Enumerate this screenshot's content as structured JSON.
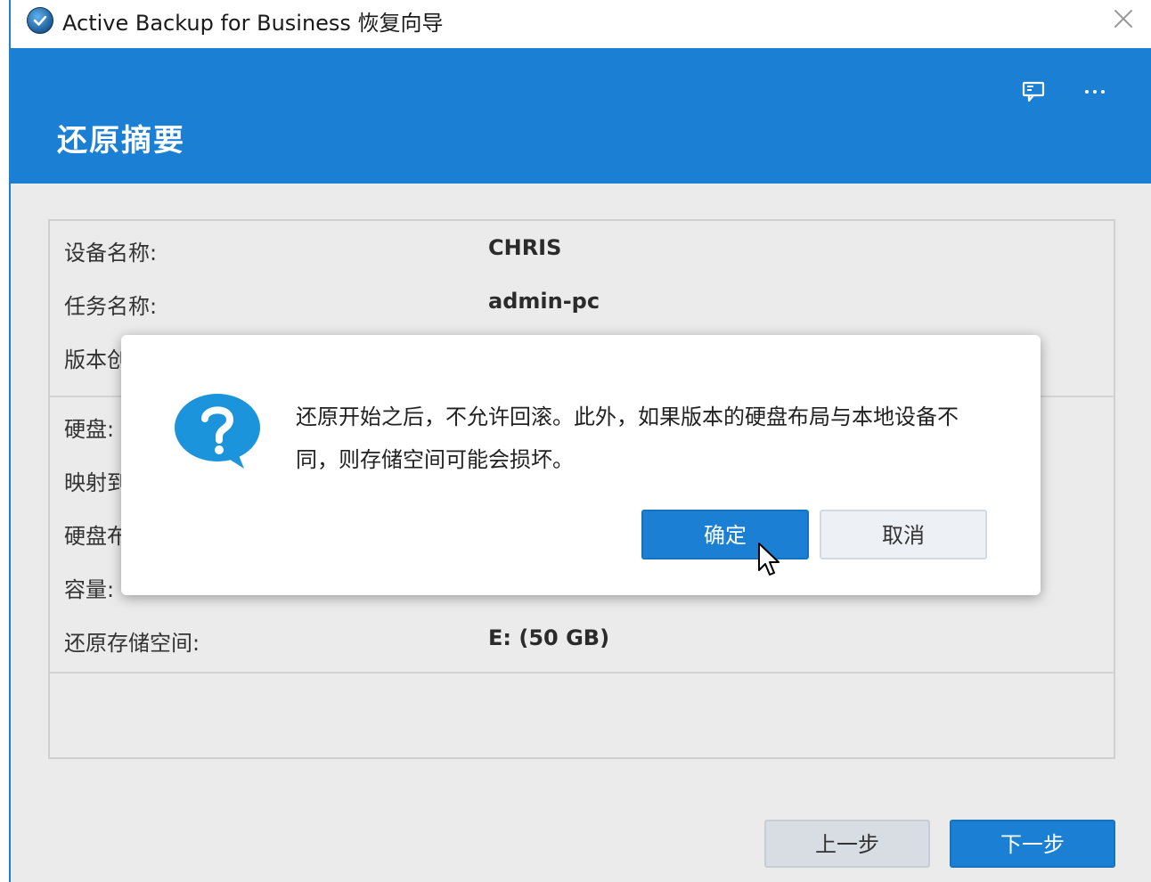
{
  "window": {
    "title": "Active Backup for Business 恢复向导"
  },
  "header": {
    "title": "还原摘要"
  },
  "summary": {
    "rows": [
      {
        "label": "设备名称:",
        "value": "CHRIS"
      },
      {
        "label": "任务名称:",
        "value": "admin-pc"
      },
      {
        "label": "版本创",
        "value": ""
      },
      {
        "label": "硬盘:",
        "value": ""
      },
      {
        "label": "映射到",
        "value": ""
      },
      {
        "label": "硬盘布",
        "value": ""
      },
      {
        "label": "容量:",
        "value": ""
      },
      {
        "label": "还原存储空间:",
        "value": "E: (50 GB)"
      }
    ]
  },
  "footer": {
    "prev_label": "上一步",
    "next_label": "下一步"
  },
  "dialog": {
    "message_line1": "还原开始之后，不允许回滚。此外，如果版本的硬盘布局与本地设备不",
    "message_line2": "同，则存储空间可能会损坏。",
    "ok_label": "确定",
    "cancel_label": "取消"
  },
  "colors": {
    "accent": "#1b7fd4",
    "background": "#ebebeb",
    "dialog_bg": "#ffffff"
  },
  "icons": {
    "app": "app-logo-icon",
    "close": "close-icon",
    "feedback": "feedback-icon",
    "more": "more-icon",
    "question": "question-bubble-icon",
    "cursor": "mouse-cursor-icon"
  }
}
